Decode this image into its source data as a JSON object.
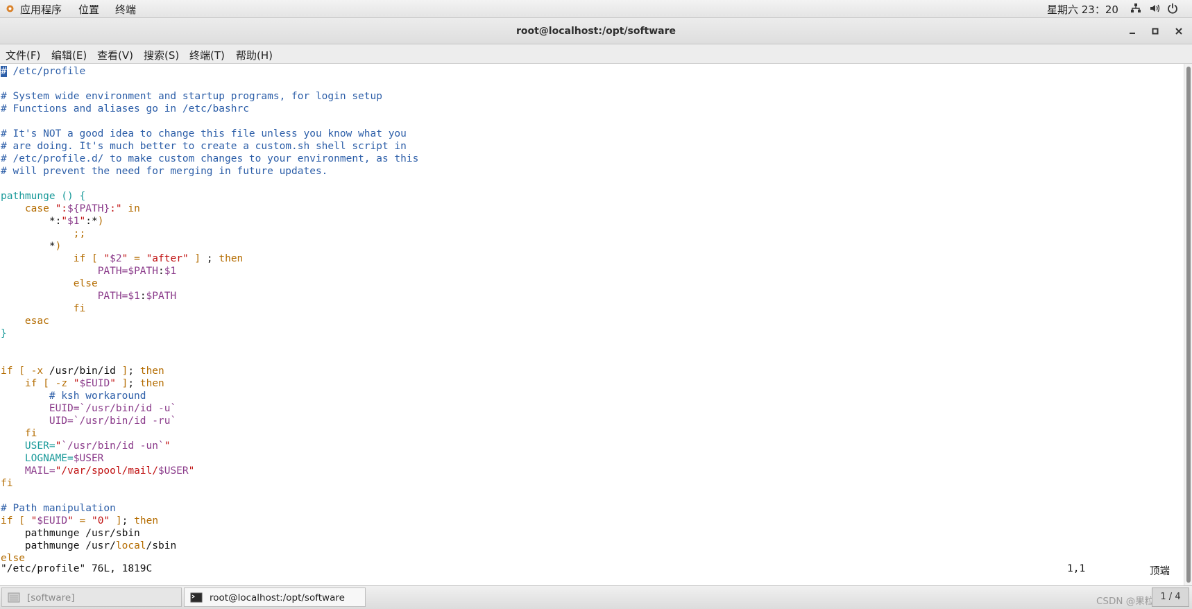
{
  "topbar": {
    "applications": "应用程序",
    "places": "位置",
    "terminal": "终端",
    "clock": "星期六 23：20"
  },
  "window": {
    "title": "root@localhost:/opt/software"
  },
  "menubar": {
    "file": "文件(F)",
    "edit": "编辑(E)",
    "view": "查看(V)",
    "search": "搜索(S)",
    "terminal": "终端(T)",
    "help": "帮助(H)"
  },
  "editor": {
    "lines": [
      [
        {
          "t": "#",
          "c": "cur"
        },
        {
          "t": " /etc/profile",
          "c": "cm"
        }
      ],
      [],
      [
        {
          "t": "# System wide environment and startup programs, for login setup",
          "c": "cm"
        }
      ],
      [
        {
          "t": "# Functions and aliases go in /etc/bashrc",
          "c": "cm"
        }
      ],
      [],
      [
        {
          "t": "# It's NOT a good idea to change this file unless you know what you",
          "c": "cm"
        }
      ],
      [
        {
          "t": "# are doing. It's much better to create a custom.sh shell script in",
          "c": "cm"
        }
      ],
      [
        {
          "t": "# /etc/profile.d/ to make custom changes to your environment, as this",
          "c": "cm"
        }
      ],
      [
        {
          "t": "# will prevent the need for merging in future updates.",
          "c": "cm"
        }
      ],
      [],
      [
        {
          "t": "pathmunge () {",
          "c": "fn"
        }
      ],
      [
        {
          "t": "    "
        },
        {
          "t": "case",
          "c": "kw"
        },
        {
          "t": " \":",
          "c": "st"
        },
        {
          "t": "${PATH}",
          "c": "vr"
        },
        {
          "t": ":\"",
          "c": "st"
        },
        {
          "t": " "
        },
        {
          "t": "in",
          "c": "kw"
        }
      ],
      [
        {
          "t": "        *:"
        },
        {
          "t": "\"",
          "c": "st"
        },
        {
          "t": "$1",
          "c": "vr"
        },
        {
          "t": "\"",
          "c": "st"
        },
        {
          "t": ":*"
        },
        {
          "t": ")",
          "c": "kw"
        }
      ],
      [
        {
          "t": "            "
        },
        {
          "t": ";;",
          "c": "kw"
        }
      ],
      [
        {
          "t": "        *"
        },
        {
          "t": ")",
          "c": "kw"
        }
      ],
      [
        {
          "t": "            "
        },
        {
          "t": "if",
          "c": "kw"
        },
        {
          "t": " "
        },
        {
          "t": "[",
          "c": "kw"
        },
        {
          "t": " "
        },
        {
          "t": "\"",
          "c": "st"
        },
        {
          "t": "$2",
          "c": "vr"
        },
        {
          "t": "\"",
          "c": "st"
        },
        {
          "t": " "
        },
        {
          "t": "=",
          "c": "op"
        },
        {
          "t": " "
        },
        {
          "t": "\"after\"",
          "c": "st"
        },
        {
          "t": " "
        },
        {
          "t": "]",
          "c": "kw"
        },
        {
          "t": " ; "
        },
        {
          "t": "then",
          "c": "kw"
        }
      ],
      [
        {
          "t": "                "
        },
        {
          "t": "PATH=",
          "c": "vr"
        },
        {
          "t": "$PATH",
          "c": "vr"
        },
        {
          "t": ":"
        },
        {
          "t": "$1",
          "c": "vr"
        }
      ],
      [
        {
          "t": "            "
        },
        {
          "t": "else",
          "c": "kw"
        }
      ],
      [
        {
          "t": "                "
        },
        {
          "t": "PATH=",
          "c": "vr"
        },
        {
          "t": "$1",
          "c": "vr"
        },
        {
          "t": ":"
        },
        {
          "t": "$PATH",
          "c": "vr"
        }
      ],
      [
        {
          "t": "            "
        },
        {
          "t": "fi",
          "c": "kw"
        }
      ],
      [
        {
          "t": "    "
        },
        {
          "t": "esac",
          "c": "kw"
        }
      ],
      [
        {
          "t": "}",
          "c": "fn"
        }
      ],
      [],
      [],
      [
        {
          "t": "if",
          "c": "kw"
        },
        {
          "t": " "
        },
        {
          "t": "[",
          "c": "kw"
        },
        {
          "t": " "
        },
        {
          "t": "-x",
          "c": "kw"
        },
        {
          "t": " /usr/bin/id "
        },
        {
          "t": "]",
          "c": "kw"
        },
        {
          "t": "; "
        },
        {
          "t": "then",
          "c": "kw"
        }
      ],
      [
        {
          "t": "    "
        },
        {
          "t": "if",
          "c": "kw"
        },
        {
          "t": " "
        },
        {
          "t": "[",
          "c": "kw"
        },
        {
          "t": " "
        },
        {
          "t": "-z",
          "c": "kw"
        },
        {
          "t": " "
        },
        {
          "t": "\"",
          "c": "st"
        },
        {
          "t": "$EUID",
          "c": "vr"
        },
        {
          "t": "\"",
          "c": "st"
        },
        {
          "t": " "
        },
        {
          "t": "]",
          "c": "kw"
        },
        {
          "t": "; "
        },
        {
          "t": "then",
          "c": "kw"
        }
      ],
      [
        {
          "t": "        "
        },
        {
          "t": "# ksh workaround",
          "c": "cm"
        }
      ],
      [
        {
          "t": "        "
        },
        {
          "t": "EUID=",
          "c": "vr"
        },
        {
          "t": "`/usr/bin/id -u`",
          "c": "vr"
        }
      ],
      [
        {
          "t": "        "
        },
        {
          "t": "UID=",
          "c": "vr"
        },
        {
          "t": "`/usr/bin/id -ru`",
          "c": "vr"
        }
      ],
      [
        {
          "t": "    "
        },
        {
          "t": "fi",
          "c": "kw"
        }
      ],
      [
        {
          "t": "    "
        },
        {
          "t": "USER=",
          "c": "fn"
        },
        {
          "t": "\"",
          "c": "st"
        },
        {
          "t": "`/usr/bin/id -un`",
          "c": "vr"
        },
        {
          "t": "\"",
          "c": "st"
        }
      ],
      [
        {
          "t": "    "
        },
        {
          "t": "LOGNAME=",
          "c": "fn"
        },
        {
          "t": "$USER",
          "c": "vr"
        }
      ],
      [
        {
          "t": "    "
        },
        {
          "t": "MAIL=",
          "c": "vr"
        },
        {
          "t": "\"/var/spool/mail/",
          "c": "st"
        },
        {
          "t": "$USER",
          "c": "vr"
        },
        {
          "t": "\"",
          "c": "st"
        }
      ],
      [
        {
          "t": "fi",
          "c": "kw"
        }
      ],
      [],
      [
        {
          "t": "# Path manipulation",
          "c": "cm"
        }
      ],
      [
        {
          "t": "if",
          "c": "kw"
        },
        {
          "t": " "
        },
        {
          "t": "[",
          "c": "kw"
        },
        {
          "t": " "
        },
        {
          "t": "\"",
          "c": "st"
        },
        {
          "t": "$EUID",
          "c": "vr"
        },
        {
          "t": "\"",
          "c": "st"
        },
        {
          "t": " "
        },
        {
          "t": "=",
          "c": "op"
        },
        {
          "t": " "
        },
        {
          "t": "\"0\"",
          "c": "st"
        },
        {
          "t": " "
        },
        {
          "t": "]",
          "c": "kw"
        },
        {
          "t": "; "
        },
        {
          "t": "then",
          "c": "kw"
        }
      ],
      [
        {
          "t": "    pathmunge /usr/sbin"
        }
      ],
      [
        {
          "t": "    pathmunge /usr/"
        },
        {
          "t": "local",
          "c": "kw"
        },
        {
          "t": "/sbin"
        }
      ],
      [
        {
          "t": "else",
          "c": "kw"
        }
      ]
    ],
    "status_file": "\"/etc/profile\" 76L, 1819C",
    "status_position": "1,1",
    "status_scroll": "顶端"
  },
  "taskbar": {
    "task1": "[software]",
    "task2": "root@localhost:/opt/software",
    "watermark": "CSDN @果粒橙",
    "workspace": "1 / 4"
  }
}
